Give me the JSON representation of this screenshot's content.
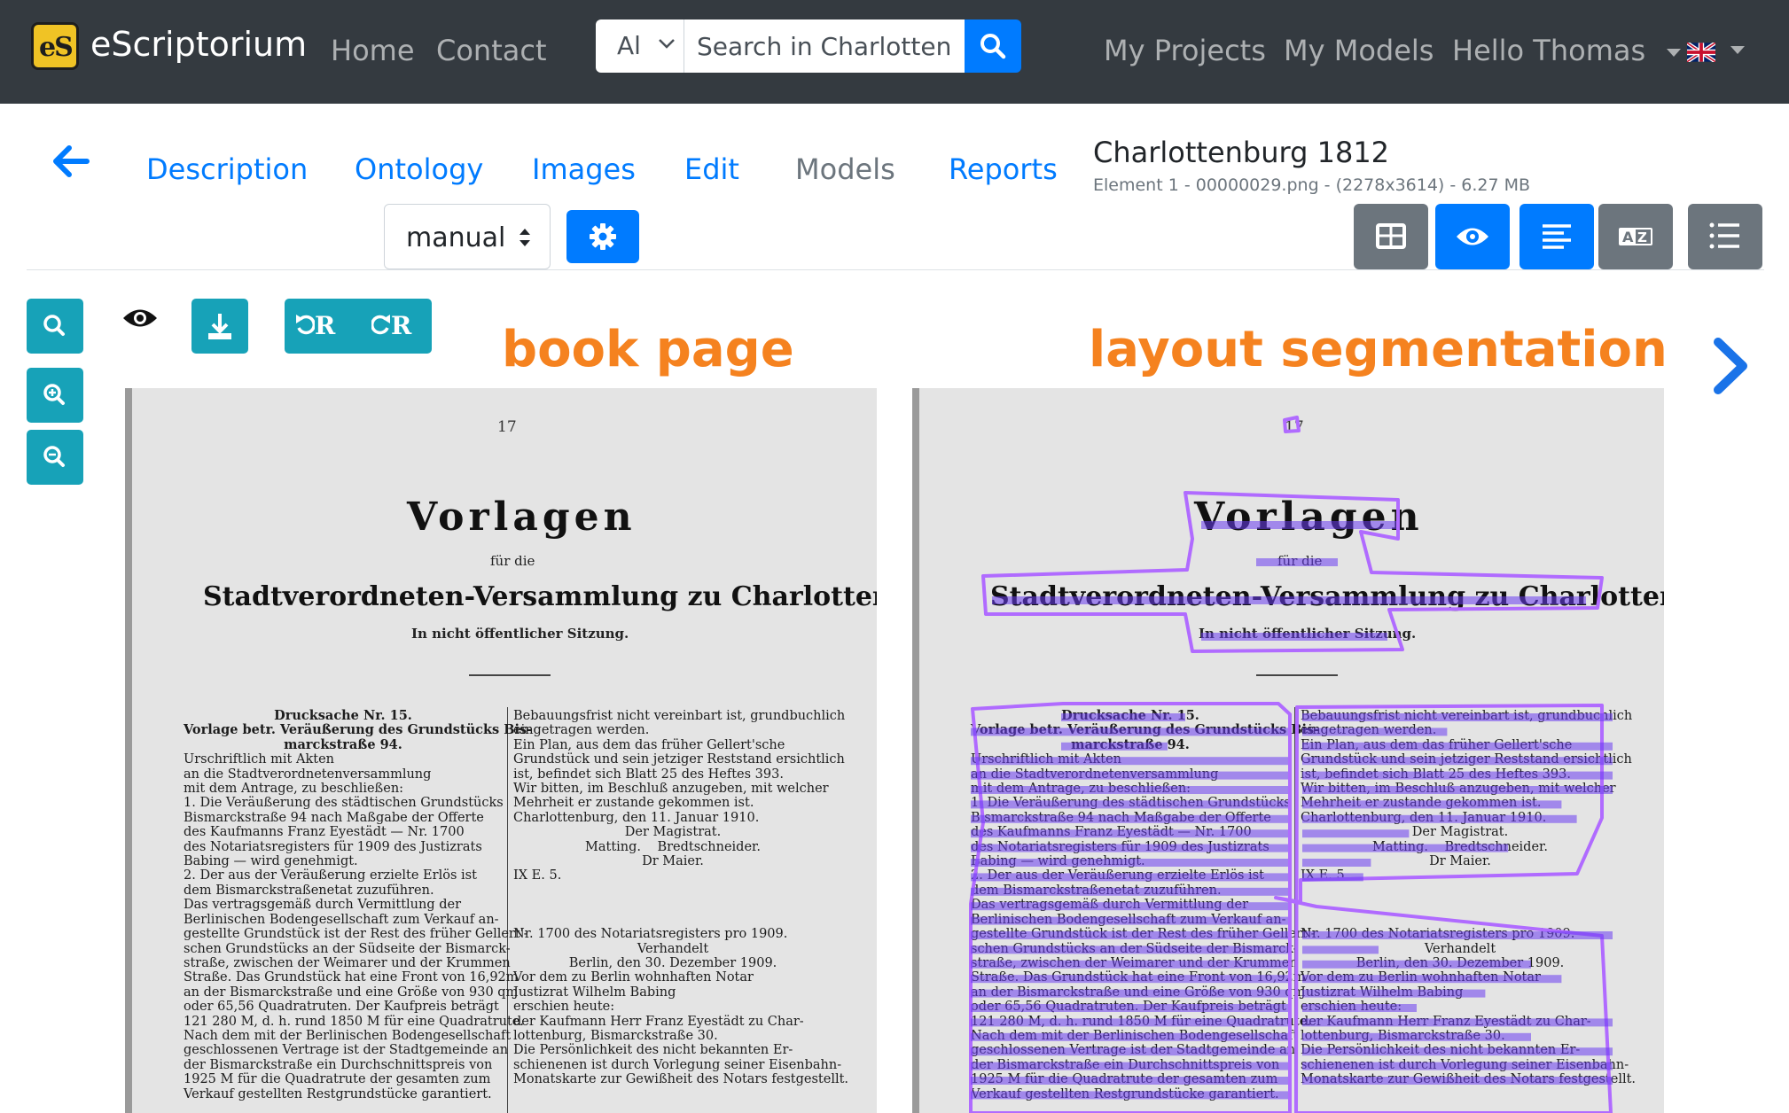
{
  "navbar": {
    "brand_logo_text": "eS",
    "brand": "eScriptorium",
    "links": [
      "Home",
      "Contact"
    ],
    "search": {
      "scope": "Al",
      "value": "Search in Charlottenburg"
    },
    "right_links": [
      "My Projects",
      "My Models"
    ],
    "user": "Hello Thomas"
  },
  "tabs": {
    "items": [
      "Description",
      "Ontology",
      "Images",
      "Edit",
      "Models",
      "Reports"
    ],
    "active": "Models"
  },
  "document": {
    "title": "Charlottenburg 1812",
    "meta": "Element 1 - 00000029.png - (2278x3614) - 6.27 MB"
  },
  "toolbar": {
    "mode_value": "manual"
  },
  "undo": {
    "undo_label": "R",
    "redo_label": "R"
  },
  "annotations": {
    "left": "book page",
    "right": "layout segmentation"
  },
  "book_page": {
    "page_number": "17",
    "heading": "Vorlagen",
    "sub": "für die",
    "heading2": "Stadtverordneten-Versammlung zu Charlottenburg.",
    "heading3": "In nicht öffentlicher Sitzung.",
    "left_column": [
      "Drucksache Nr. 15.",
      "Vorlage betr. Veräußerung des Grundstücks Bis-",
      "marckstraße 94.",
      "Urschriftlich mit Akten",
      "an die Stadtverordnetenversammlung",
      "mit dem Antrage, zu beschließen:",
      "1. Die Veräußerung des städtischen Grundstücks",
      "Bismarckstraße 94 nach Maßgabe der Offerte",
      "des Kaufmanns Franz Eyestädt — Nr. 1700",
      "des Notariatsregisters für 1909 des Justizrats",
      "Babing — wird genehmigt.",
      "2. Der aus der Veräußerung erzielte Erlös ist",
      "dem Bismarckstraßenetat zuzuführen.",
      "Das vertragsgemäß durch Vermittlung der",
      "Berlinischen Bodengesellschaft zum Verkauf an-",
      "gestellte Grundstück ist der Rest des früher Gellert'-",
      "schen Grundstücks an der Südseite der Bismarck-",
      "straße, zwischen der Weimarer und der Krummen",
      "Straße. Das Grundstück hat eine Front von 16,92m",
      "an der Bismarckstraße und eine Größe von 930 qm",
      "oder 65,56 Quadratruten. Der Kaufpreis beträgt",
      "121 280 M, d. h. rund 1850 M für eine Quadratrute.",
      "Nach dem mit der Berlinischen Bodengesellschaft",
      "geschlossenen Vertrage ist der Stadtgemeinde an",
      "der Bismarckstraße ein Durchschnittspreis von",
      "1925 M für die Quadratrute der gesamten zum",
      "Verkauf gestellten Restgrundstücke garantiert."
    ],
    "right_column": [
      "Bebauungsfrist nicht vereinbart ist, grundbuchlich",
      "eingetragen werden.",
      "Ein Plan, aus dem das früher Gellert'sche",
      "Grundstück und sein jetziger Reststand ersichtlich",
      "ist, befindet sich Blatt 25 des Heftes 393.",
      "Wir bitten, im Beschluß anzugeben, mit welcher",
      "Mehrheit er zustande gekommen ist.",
      "Charlottenburg, den 11. Januar 1910.",
      "Der Magistrat.",
      "Matting.    Bredtschneider.",
      "Dr Maier.",
      "IX E. 5.",
      "",
      "",
      "",
      "Nr. 1700 des Notariatsregisters pro 1909.",
      "Verhandelt",
      "Berlin, den 30. Dezember 1909.",
      "Vor dem zu Berlin wohnhaften Notar",
      "Justizrat Wilhelm Babing",
      "erschien heute:",
      "der Kaufmann Herr Franz Eyestädt zu Char-",
      "lottenburg, Bismarckstraße 30.",
      "Die Persönlichkeit des nicht bekannten Er-",
      "schienenen ist durch Vorlegung seiner Eisenbahn-",
      "Monatskarte zur Gewißheit des Notars festgestellt."
    ]
  },
  "colors": {
    "navbar": "#343a40",
    "primary": "#007bff",
    "info": "#17a2b8",
    "secondary": "#6c757d",
    "annotation": "#f5821f",
    "segment_region": "#b06bff",
    "segment_line": "#6a3cf0"
  },
  "icons": [
    "search-icon",
    "chevron-down-icon",
    "caret-down-icon",
    "flag-uk-icon",
    "arrow-left-icon",
    "updown-icon",
    "gear-icon",
    "table-icon",
    "eye-icon",
    "align-left-icon",
    "translate-icon",
    "list-icon",
    "zoom-icon",
    "zoom-in-icon",
    "zoom-out-icon",
    "download-icon",
    "undo-icon",
    "redo-icon",
    "chevron-right-icon"
  ]
}
